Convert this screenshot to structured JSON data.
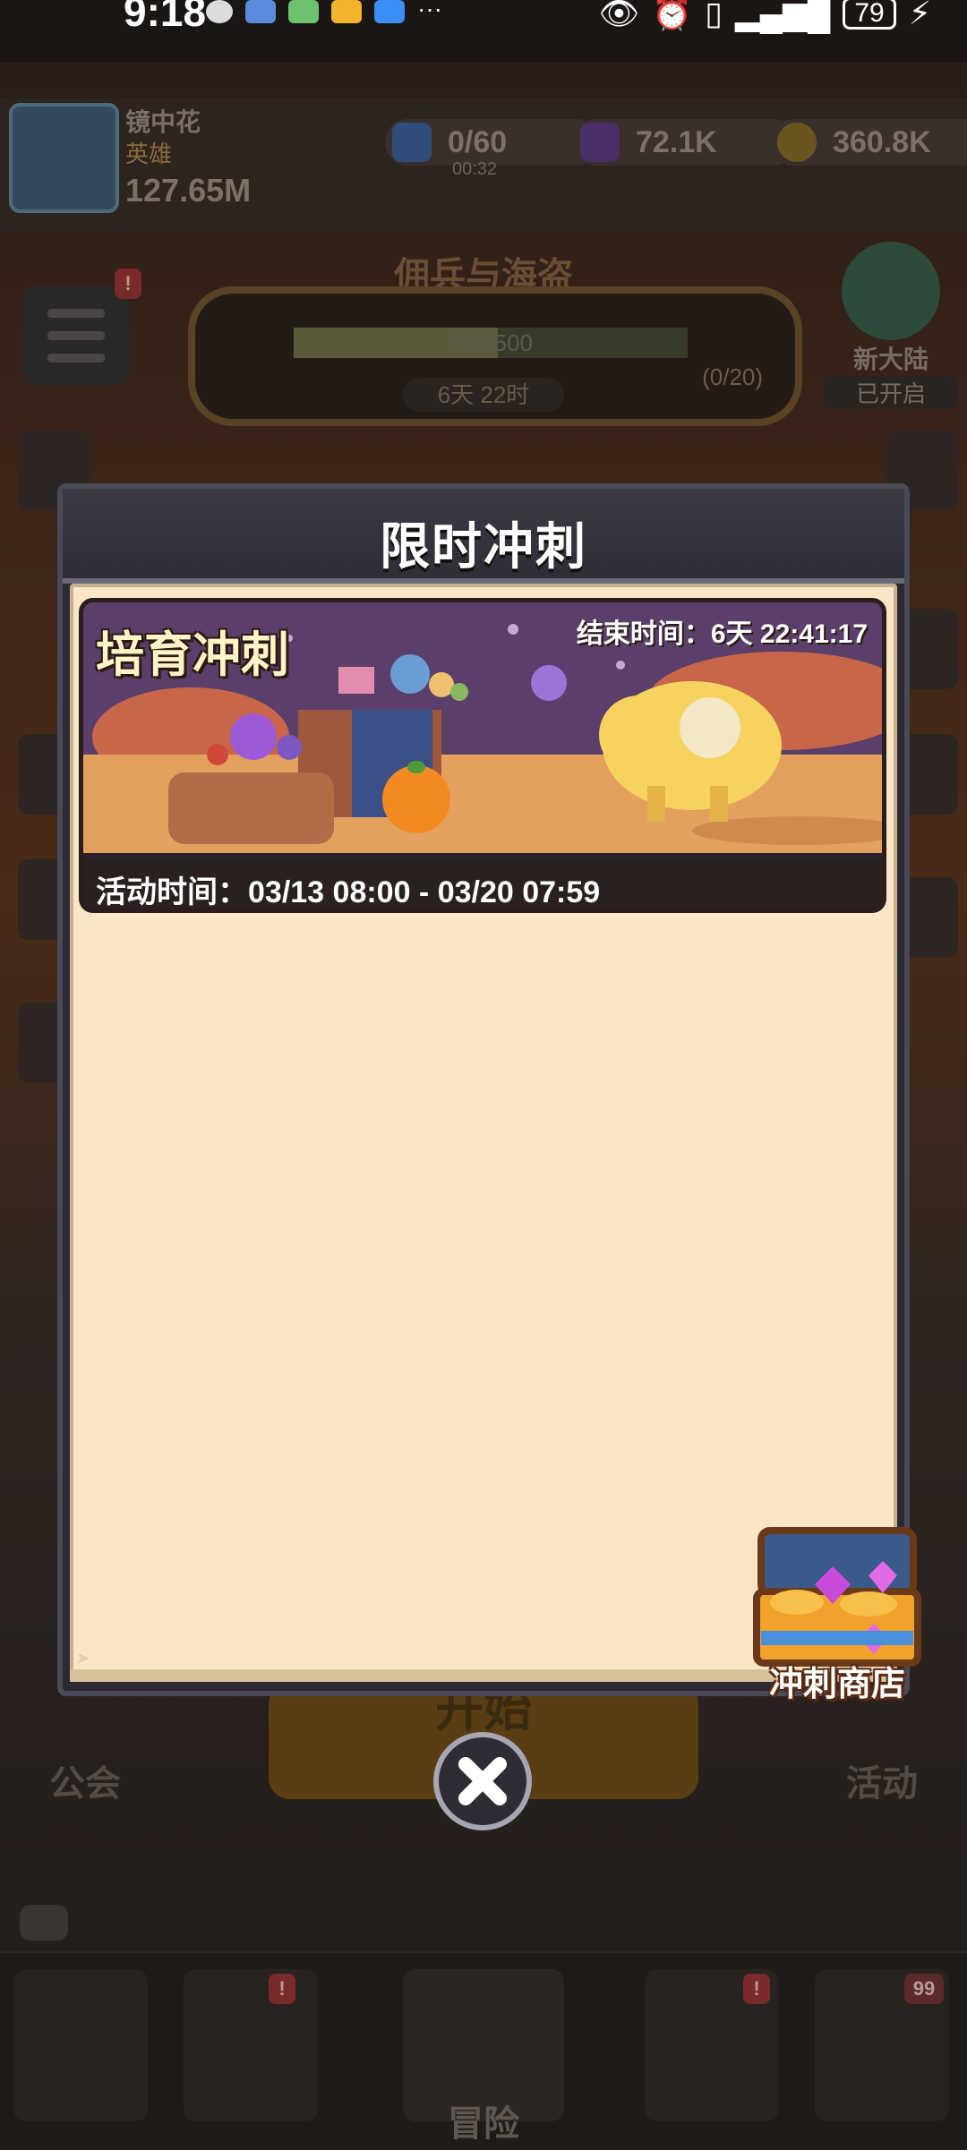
{
  "status_bar": {
    "time": "9:18",
    "more": "···",
    "battery": "79"
  },
  "background": {
    "player": {
      "name": "镜中花",
      "rank": "英雄",
      "power": "127.65M"
    },
    "resources": {
      "energy": "0/60",
      "energy_timer": "00:32",
      "gems": "72.1K",
      "gold": "360.8K"
    },
    "event_banner": {
      "title": "佣兵与海盗",
      "progress": "259/500",
      "progress_fraction": 0.518,
      "extra": "(0/20)",
      "timer": "6天 22时"
    },
    "new_continent": {
      "line1": "新大陆",
      "line2": "已开启"
    },
    "bottom": {
      "guild": "公会",
      "start": "开始",
      "activity": "活动",
      "adventure": "冒险",
      "badge_count": "99"
    }
  },
  "modal": {
    "title": "限时冲刺",
    "event_card": {
      "name": "培育冲刺",
      "end_time": "结束时间：6天 22:41:17",
      "activity_time": "活动时间：03/13 08:00 - 03/20 07:59"
    },
    "shop_label": "冲刺商店",
    "close_icon": "close-icon"
  },
  "colors": {
    "parchment": "#f8e6c6",
    "modal_header": "#2f2e37",
    "card_bg": "#5a3f6a"
  }
}
